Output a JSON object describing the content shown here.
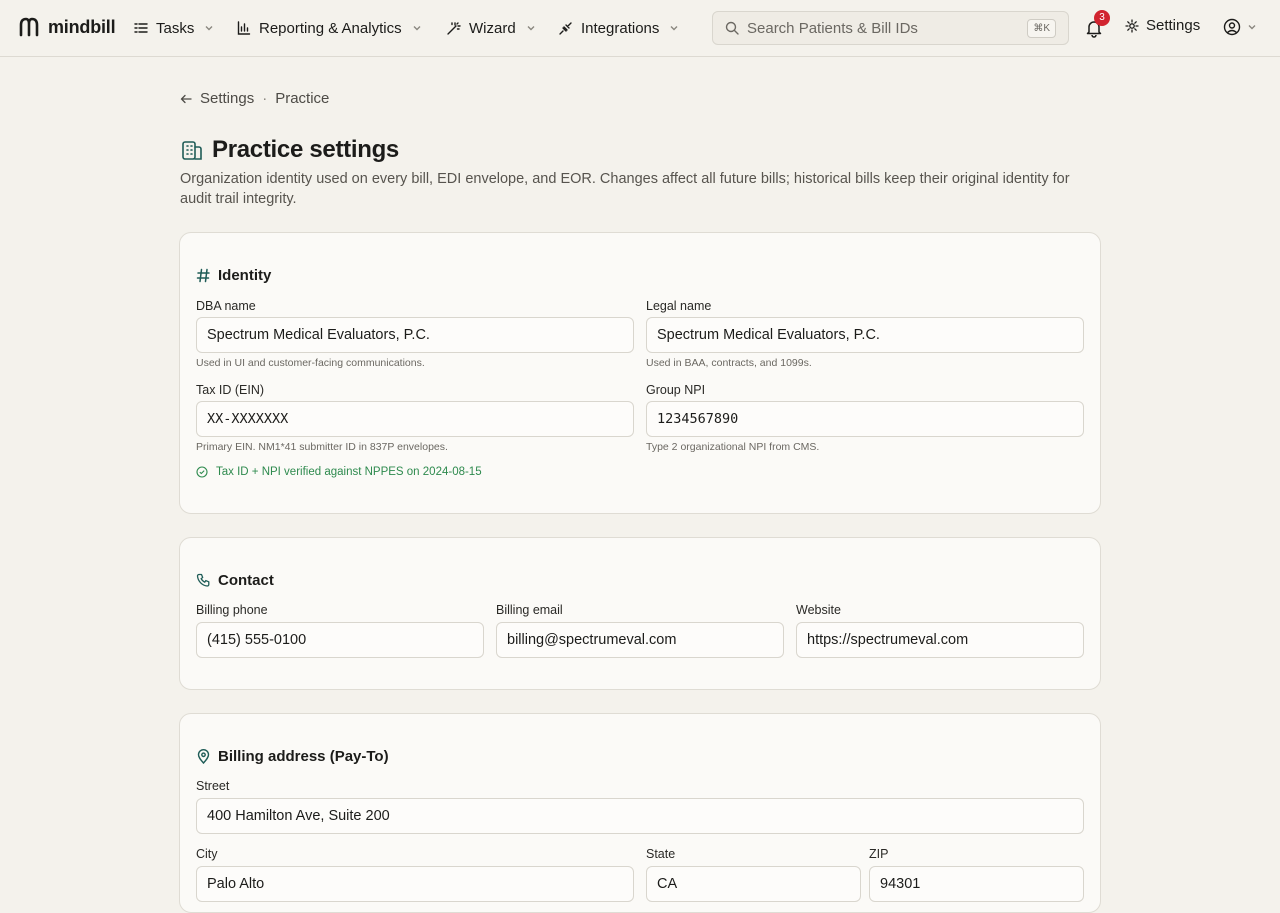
{
  "nav": {
    "brand": "mindbill",
    "tasks_label": "Tasks",
    "reporting_label": "Reporting & Analytics",
    "wizard_label": "Wizard",
    "integrations_label": "Integrations",
    "search_placeholder": "Search Patients & Bill IDs",
    "search_shortcut": "⌘K",
    "notification_count": "3",
    "settings_label": "Settings"
  },
  "breadcrumb": {
    "parent": "Settings",
    "separator": "·",
    "current": "Practice"
  },
  "page": {
    "title": "Practice settings",
    "description": "Organization identity used on every bill, EDI envelope, and EOR. Changes affect all future bills; historical bills keep their original identity for audit trail integrity."
  },
  "identity": {
    "heading": "Identity",
    "dba_label": "DBA name",
    "dba_value": "Spectrum Medical Evaluators, P.C.",
    "dba_help": "Used in UI and customer-facing communications.",
    "legal_label": "Legal name",
    "legal_value": "Spectrum Medical Evaluators, P.C.",
    "legal_help": "Used in BAA, contracts, and 1099s.",
    "ein_label": "Tax ID (EIN)",
    "ein_value": "XX-XXXXXXX",
    "ein_help": "Primary EIN. NM1*41 submitter ID in 837P envelopes.",
    "npi_label": "Group NPI",
    "npi_value": "1234567890",
    "npi_help": "Type 2 organizational NPI from CMS.",
    "verified_text": "Tax ID + NPI verified against NPPES on 2024-08-15"
  },
  "contact": {
    "heading": "Contact",
    "phone_label": "Billing phone",
    "phone_value": "(415) 555-0100",
    "email_label": "Billing email",
    "email_value": "billing@spectrumeval.com",
    "website_label": "Website",
    "website_value": "https://spectrumeval.com"
  },
  "address": {
    "heading": "Billing address (Pay-To)",
    "street_label": "Street",
    "street_value": "400 Hamilton Ave, Suite 200",
    "city_label": "City",
    "city_value": "Palo Alto",
    "state_label": "State",
    "state_value": "CA",
    "zip_label": "ZIP",
    "zip_value": "94301"
  },
  "colors": {
    "background": "#f4f2ec",
    "card": "#fbfaf7",
    "accent": "#1f5c57",
    "verified": "#2e8a4e",
    "badge": "#d1242f"
  },
  "icons": [
    "mindbill-logo-icon",
    "tasks-icon",
    "chart-icon",
    "wand-icon",
    "plug-icon",
    "search-icon",
    "bell-icon",
    "gear-icon",
    "user-circle-icon",
    "arrow-left-icon",
    "building-icon",
    "hash-icon",
    "phone-icon",
    "map-pin-icon",
    "check-circle-icon"
  ]
}
